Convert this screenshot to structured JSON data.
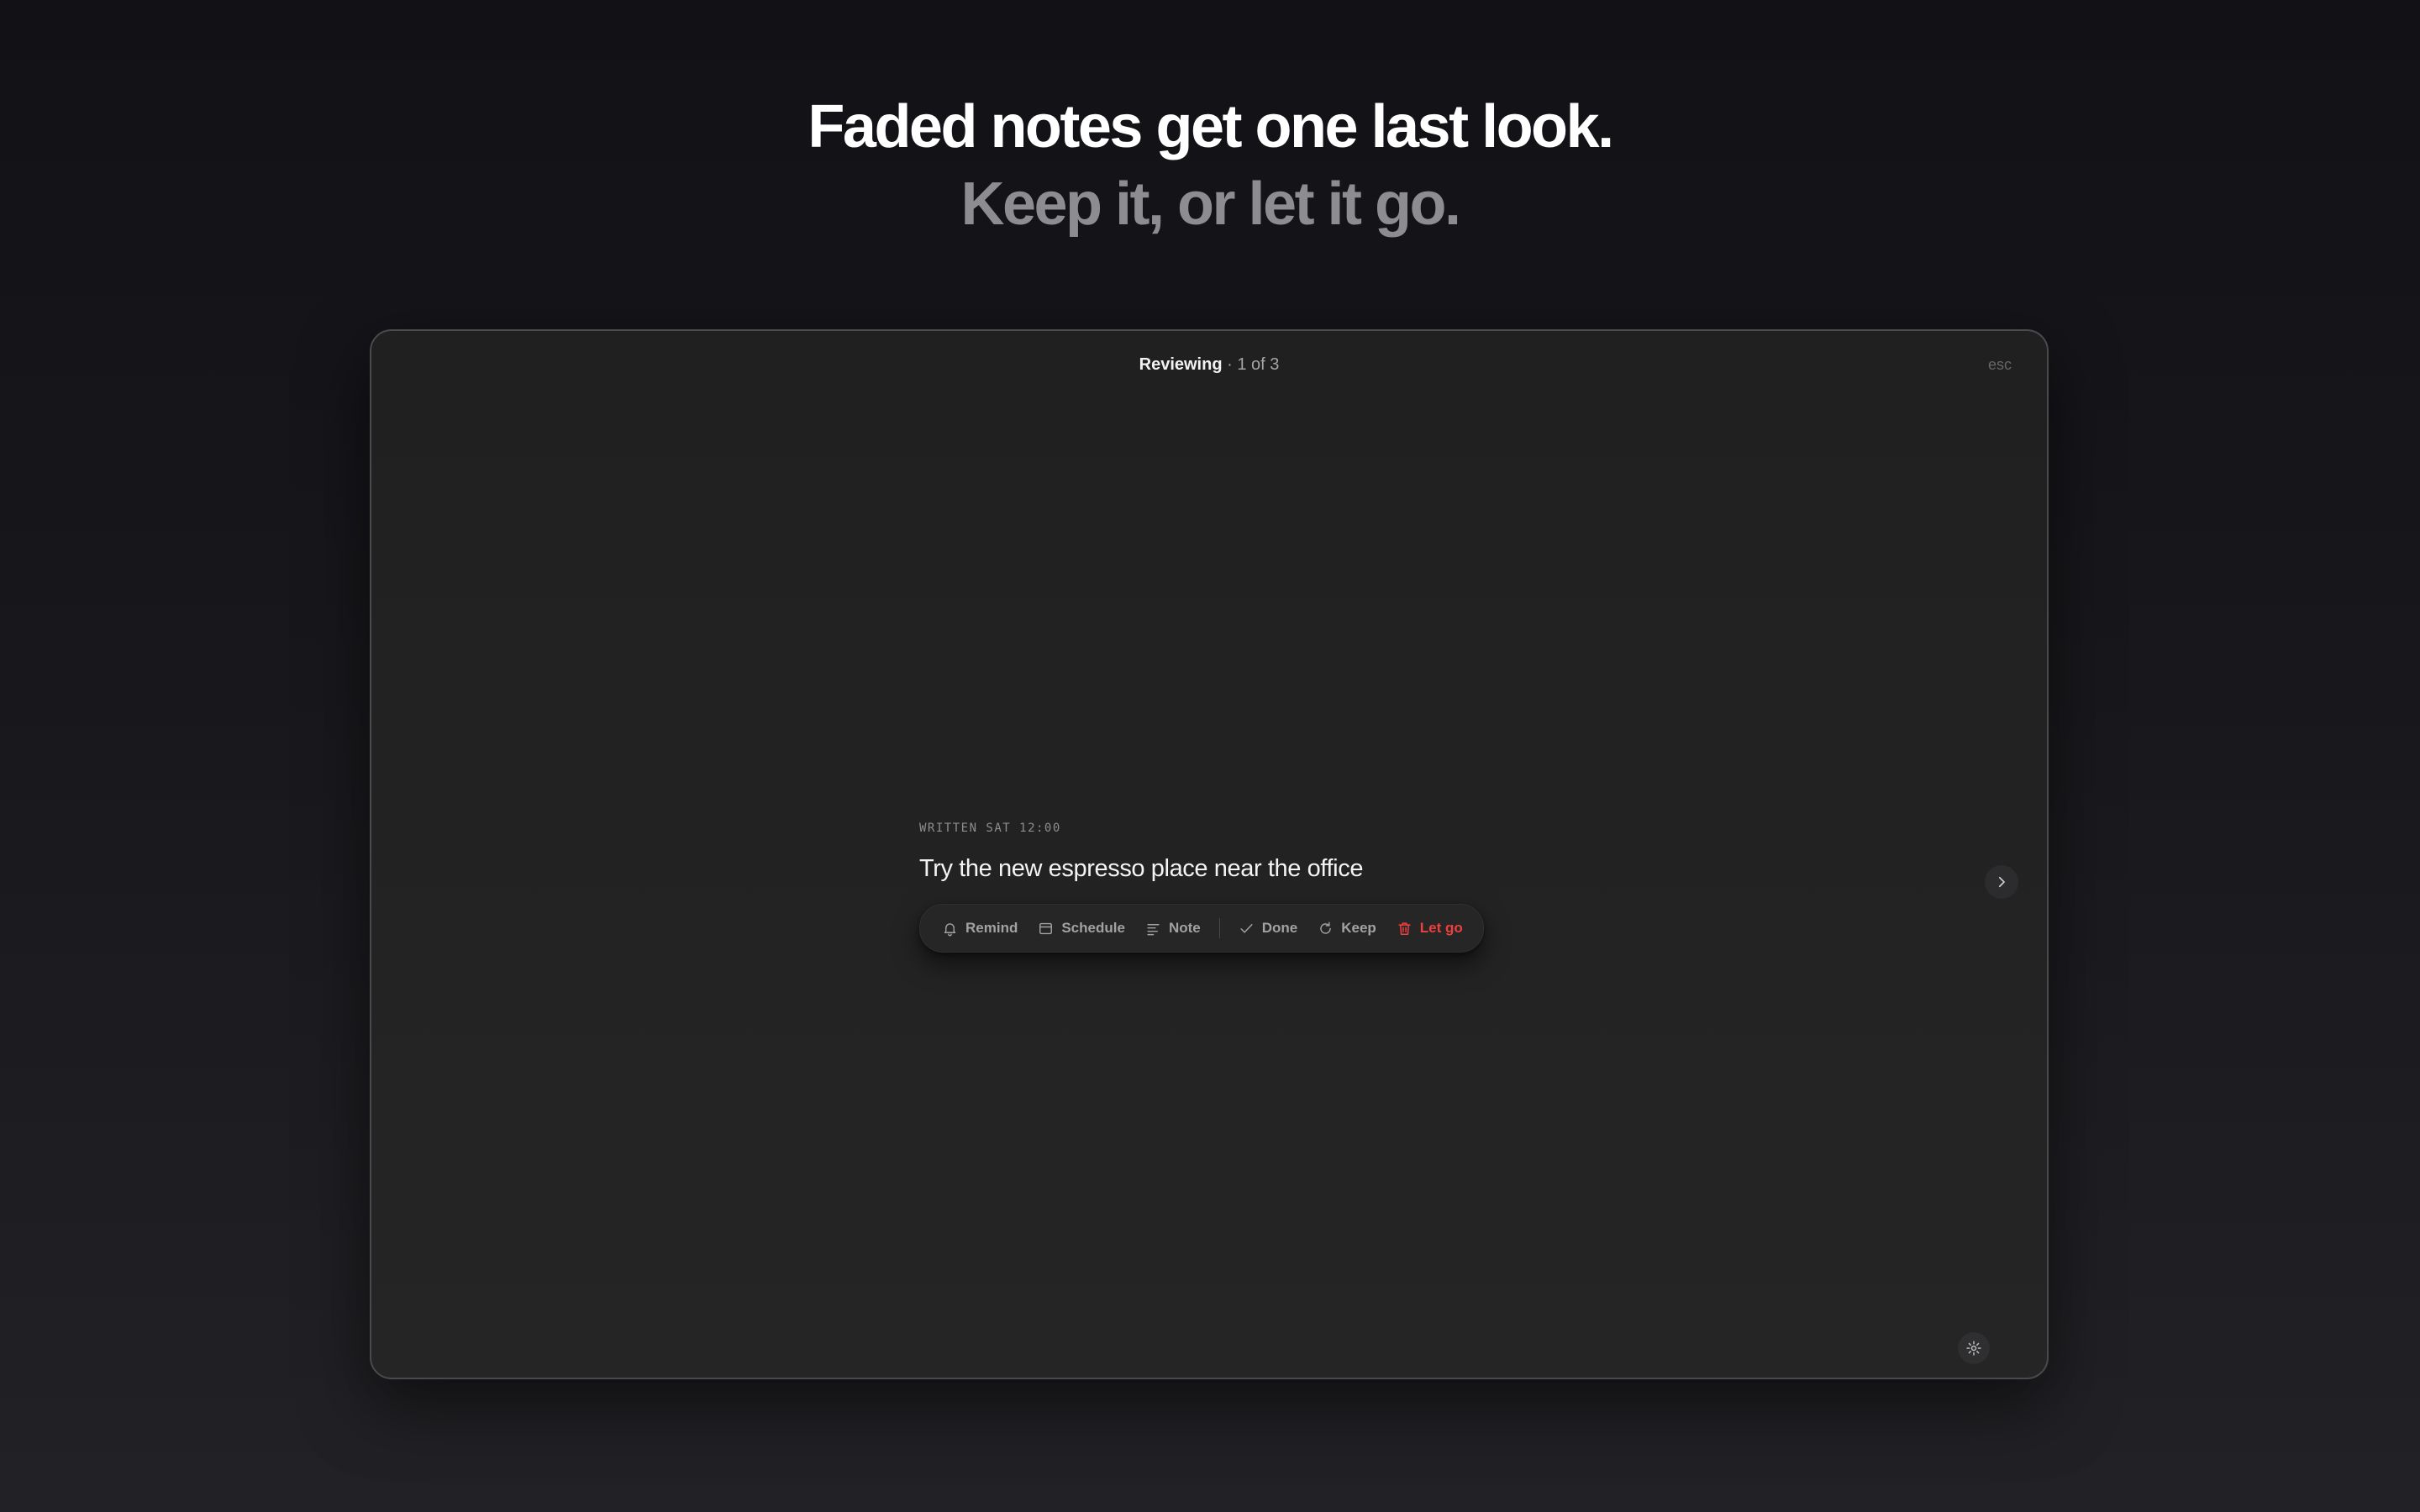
{
  "hero": {
    "line1": "Faded notes get one last look.",
    "line2": "Keep it, or let it go."
  },
  "window": {
    "title_strong": "Reviewing",
    "title_rest": " · 1 of 3",
    "esc_label": "esc"
  },
  "card": {
    "written": "WRITTEN SAT 12:00",
    "text": "Try the new espresso place near the office"
  },
  "actions": {
    "remind": "Remind",
    "schedule": "Schedule",
    "note": "Note",
    "done": "Done",
    "keep": "Keep",
    "let_go": "Let go"
  },
  "icons": {
    "remind": "bell-icon",
    "schedule": "calendar-icon",
    "note": "text-lines-icon",
    "done": "checkmark-icon",
    "keep": "refresh-icon",
    "let_go": "trash-icon",
    "next": "chevron-right-icon",
    "settings": "gear-icon"
  },
  "colors": {
    "danger": "#ef3f3f",
    "muted_text": "#a2a2a5"
  }
}
